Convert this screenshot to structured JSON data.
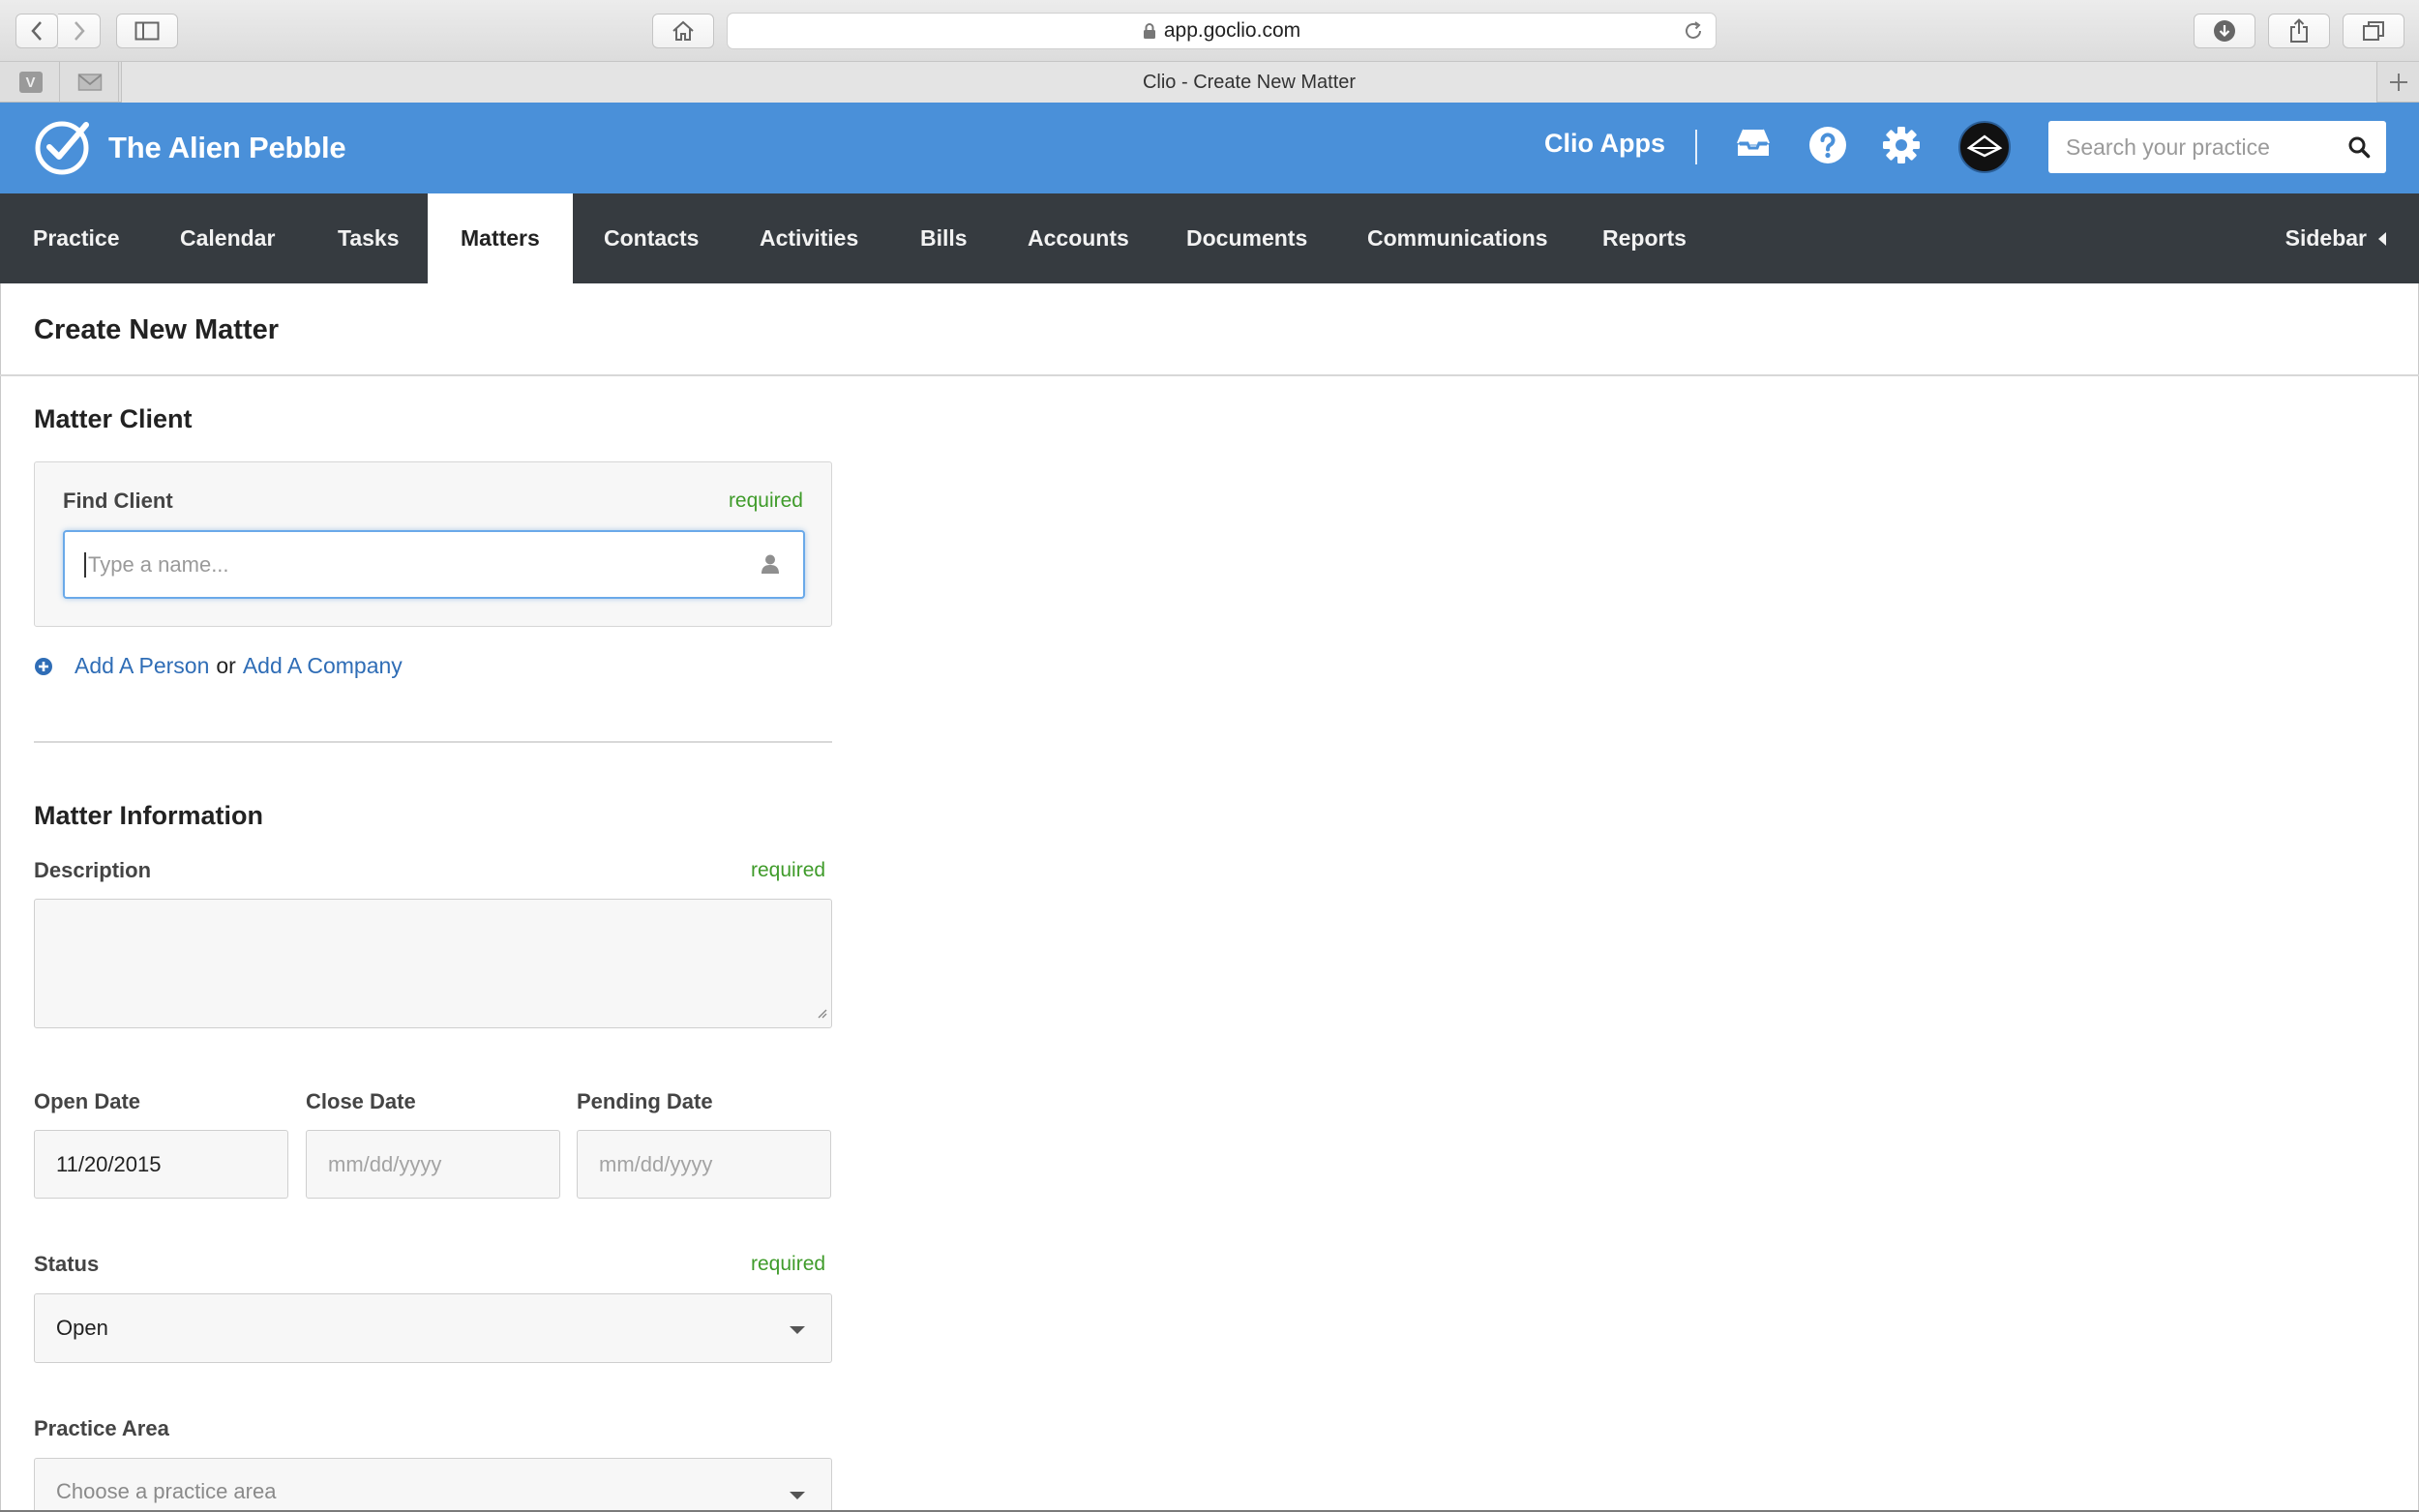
{
  "browser": {
    "url": "app.goclio.com",
    "tab_title": "Clio - Create New Matter",
    "pinned_tabs": [
      "V",
      "mail"
    ]
  },
  "header": {
    "brand_name": "The Alien Pebble",
    "apps_label": "Clio Apps",
    "search_placeholder": "Search your practice",
    "colors": {
      "bar": "#4a90d9",
      "nav": "#363b40",
      "required": "#3f9b2a",
      "link": "#2f6db6"
    }
  },
  "nav": {
    "items": [
      "Practice",
      "Calendar",
      "Tasks",
      "Matters",
      "Contacts",
      "Activities",
      "Bills",
      "Accounts",
      "Documents",
      "Communications",
      "Reports"
    ],
    "active": "Matters",
    "sidebar_label": "Sidebar"
  },
  "page": {
    "title": "Create New Matter"
  },
  "matter_client": {
    "section_title": "Matter Client",
    "find_label": "Find Client",
    "required_label": "required",
    "input_placeholder": "Type a name...",
    "add_person": "Add A Person",
    "or_text": "or",
    "add_company": "Add A Company"
  },
  "matter_info": {
    "section_title": "Matter Information",
    "description_label": "Description",
    "description_required": "required",
    "open_date_label": "Open Date",
    "open_date_value": "11/20/2015",
    "close_date_label": "Close Date",
    "close_date_placeholder": "mm/dd/yyyy",
    "pending_date_label": "Pending Date",
    "pending_date_placeholder": "mm/dd/yyyy",
    "status_label": "Status",
    "status_required": "required",
    "status_value": "Open",
    "practice_area_label": "Practice Area",
    "practice_area_placeholder": "Choose a practice area"
  }
}
